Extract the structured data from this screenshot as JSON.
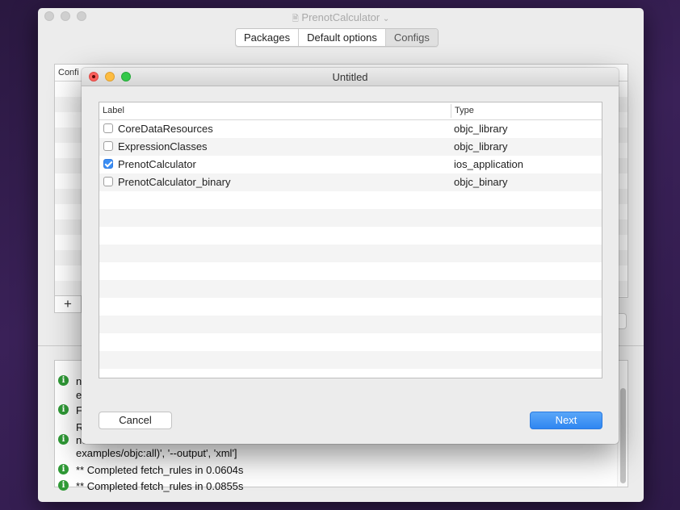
{
  "window": {
    "title": "PrenotCalculator"
  },
  "segmented": [
    "Packages",
    "Default options",
    "Configs"
  ],
  "bg_table": {
    "header": "Confi",
    "add_label": "+"
  },
  "log": {
    "lines": [
      {
        "text": "ne"
      },
      {
        "text": "ex"
      },
      {
        "text": "Fe"
      },
      {
        "text": "R"
      },
      {
        "text": "ne"
      },
      {
        "text": "examples/objc:all)', '--output', 'xml']"
      },
      {
        "text": "** Completed fetch_rules in 0.0604s"
      },
      {
        "text": "** Completed fetch_rules in 0.0855s"
      }
    ]
  },
  "sheet": {
    "title": "Untitled",
    "columns": {
      "label": "Label",
      "type": "Type"
    },
    "rows": [
      {
        "label": "CoreDataResources",
        "type": "objc_library",
        "checked": false
      },
      {
        "label": "ExpressionClasses",
        "type": "objc_library",
        "checked": false
      },
      {
        "label": "PrenotCalculator",
        "type": "ios_application",
        "checked": true
      },
      {
        "label": "PrenotCalculator_binary",
        "type": "objc_binary",
        "checked": false
      }
    ],
    "cancel_label": "Cancel",
    "next_label": "Next"
  },
  "colors": {
    "accent": "#3b8ef4",
    "close": "#fc605c",
    "minimize": "#fdbc40",
    "zoom": "#34c84a",
    "info": "#2f9a36"
  }
}
